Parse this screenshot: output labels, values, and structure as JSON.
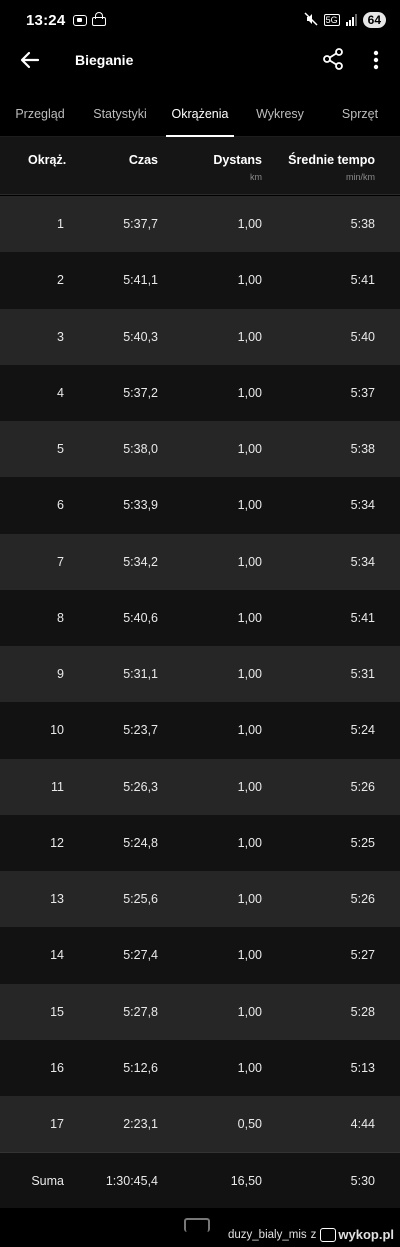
{
  "status_bar": {
    "time": "13:24",
    "network_label": "5G",
    "battery": "64"
  },
  "app_bar": {
    "title": "Bieganie"
  },
  "tabs": [
    {
      "label": "Przegląd",
      "active": false
    },
    {
      "label": "Statystyki",
      "active": false
    },
    {
      "label": "Okrążenia",
      "active": true
    },
    {
      "label": "Wykresy",
      "active": false
    },
    {
      "label": "Sprzęt",
      "active": false
    }
  ],
  "table": {
    "headers": {
      "lap": "Okrąż.",
      "time": "Czas",
      "distance": "Dystans",
      "distance_unit": "km",
      "pace": "Średnie tempo",
      "pace_unit": "min/km"
    },
    "rows": [
      {
        "lap": "1",
        "time": "5:37,7",
        "distance": "1,00",
        "pace": "5:38"
      },
      {
        "lap": "2",
        "time": "5:41,1",
        "distance": "1,00",
        "pace": "5:41"
      },
      {
        "lap": "3",
        "time": "5:40,3",
        "distance": "1,00",
        "pace": "5:40"
      },
      {
        "lap": "4",
        "time": "5:37,2",
        "distance": "1,00",
        "pace": "5:37"
      },
      {
        "lap": "5",
        "time": "5:38,0",
        "distance": "1,00",
        "pace": "5:38"
      },
      {
        "lap": "6",
        "time": "5:33,9",
        "distance": "1,00",
        "pace": "5:34"
      },
      {
        "lap": "7",
        "time": "5:34,2",
        "distance": "1,00",
        "pace": "5:34"
      },
      {
        "lap": "8",
        "time": "5:40,6",
        "distance": "1,00",
        "pace": "5:41"
      },
      {
        "lap": "9",
        "time": "5:31,1",
        "distance": "1,00",
        "pace": "5:31"
      },
      {
        "lap": "10",
        "time": "5:23,7",
        "distance": "1,00",
        "pace": "5:24"
      },
      {
        "lap": "11",
        "time": "5:26,3",
        "distance": "1,00",
        "pace": "5:26"
      },
      {
        "lap": "12",
        "time": "5:24,8",
        "distance": "1,00",
        "pace": "5:25"
      },
      {
        "lap": "13",
        "time": "5:25,6",
        "distance": "1,00",
        "pace": "5:26"
      },
      {
        "lap": "14",
        "time": "5:27,4",
        "distance": "1,00",
        "pace": "5:27"
      },
      {
        "lap": "15",
        "time": "5:27,8",
        "distance": "1,00",
        "pace": "5:28"
      },
      {
        "lap": "16",
        "time": "5:12,6",
        "distance": "1,00",
        "pace": "5:13"
      },
      {
        "lap": "17",
        "time": "2:23,1",
        "distance": "0,50",
        "pace": "4:44"
      }
    ],
    "summary": {
      "lap": "Suma",
      "time": "1:30:45,4",
      "distance": "16,50",
      "pace": "5:30"
    }
  },
  "watermark": {
    "author": "duzy_bialy_mis",
    "connector": "z",
    "site": "wykop.pl"
  },
  "colors": {
    "background": "#000000",
    "row_alt": "#262626",
    "row_base": "#121212",
    "header_bg": "#151515",
    "text_secondary": "#bdbdbd"
  }
}
